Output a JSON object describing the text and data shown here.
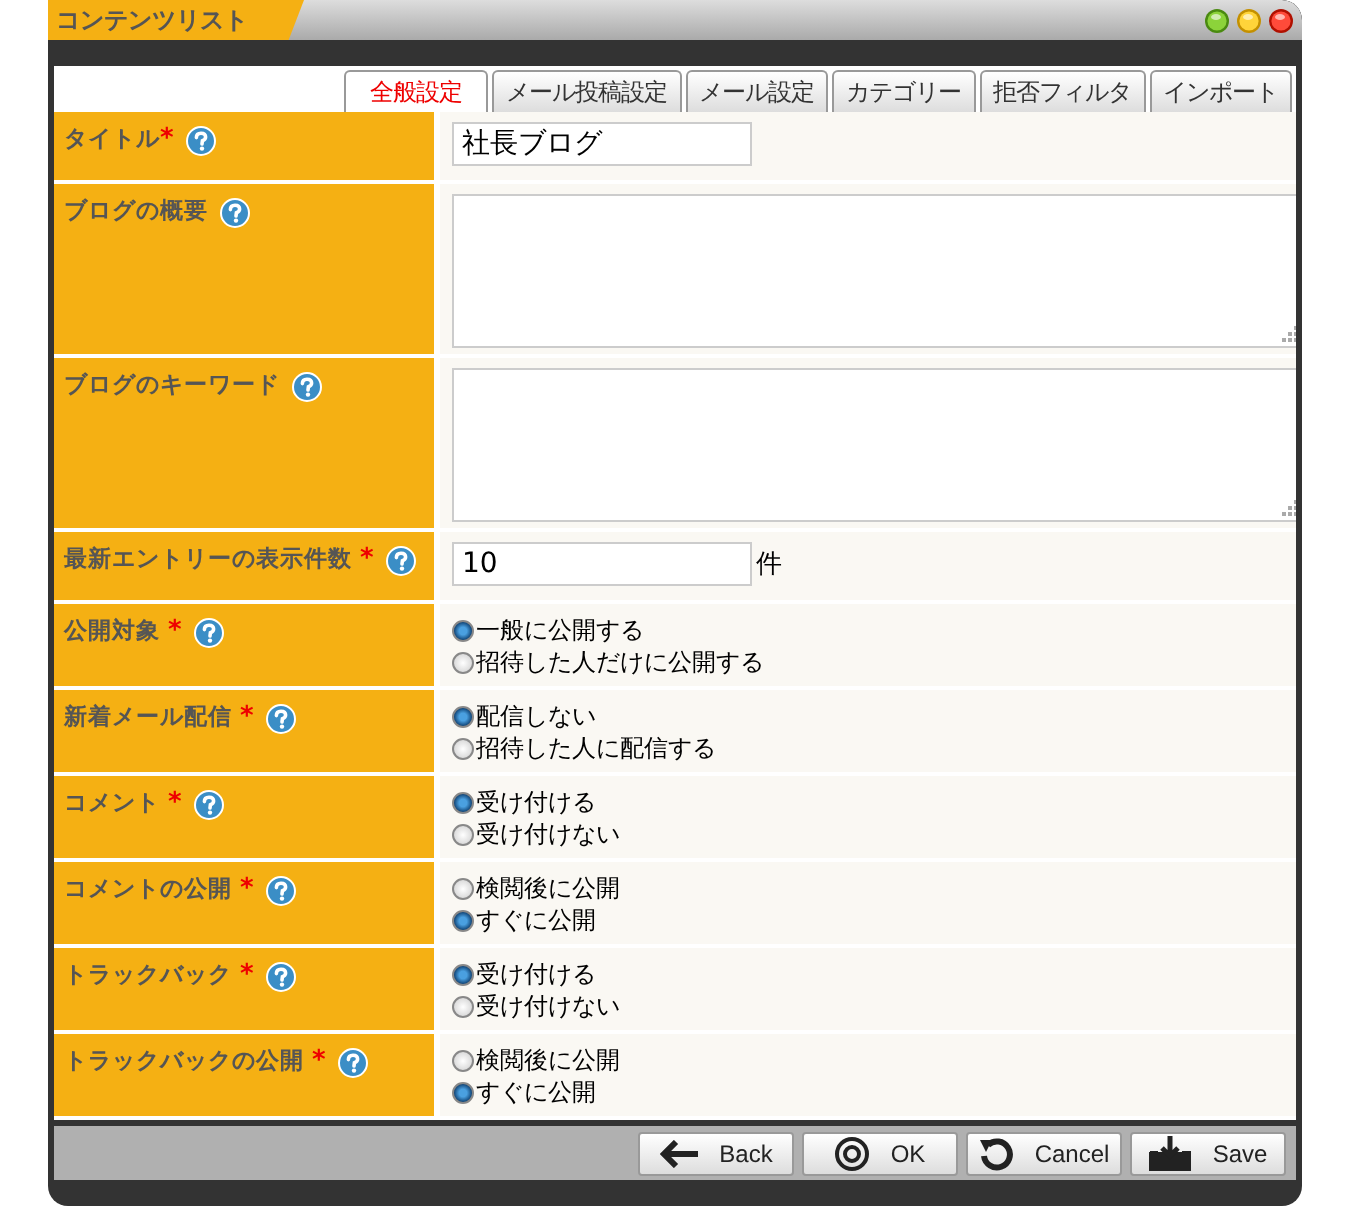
{
  "window": {
    "title": "コンテンツリスト"
  },
  "tabs": [
    {
      "label": "全般設定",
      "selected": true
    },
    {
      "label": "メール投稿設定",
      "selected": false
    },
    {
      "label": "メール設定",
      "selected": false
    },
    {
      "label": "カテゴリー",
      "selected": false
    },
    {
      "label": "拒否フィルタ",
      "selected": false
    },
    {
      "label": "インポート",
      "selected": false
    }
  ],
  "fields": [
    {
      "kind": "text",
      "label": "タイトル",
      "mark": "*",
      "value": "社長ブログ"
    },
    {
      "kind": "textarea",
      "label": "ブログの概要"
    },
    {
      "kind": "textarea",
      "label": "ブログのキーワード"
    },
    {
      "kind": "text",
      "label": "最新エントリーの表示件数",
      "mark": "*",
      "value": "10",
      "unit": "件"
    },
    {
      "kind": "radio",
      "label": "公開対象",
      "mark": "*",
      "options": [
        {
          "label": "一般に公開する",
          "selected": true
        },
        {
          "label": "招待した人だけに公開する",
          "selected": false
        }
      ]
    },
    {
      "kind": "radio",
      "label": "新着メール配信",
      "mark": "*",
      "options": [
        {
          "label": "配信しない",
          "selected": true
        },
        {
          "label": "招待した人に配信する",
          "selected": false
        }
      ]
    },
    {
      "kind": "radio",
      "label": "コメント",
      "mark": "*",
      "options": [
        {
          "label": "受け付ける",
          "selected": true
        },
        {
          "label": "受け付けない",
          "selected": false
        }
      ]
    },
    {
      "kind": "radio",
      "label": "コメントの公開",
      "mark": "*",
      "options": [
        {
          "label": "検閲後に公開",
          "selected": false
        },
        {
          "label": "すぐに公開",
          "selected": true
        }
      ]
    },
    {
      "kind": "radio",
      "label": "トラックバック",
      "mark": "*",
      "options": [
        {
          "label": "受け付ける",
          "selected": true
        },
        {
          "label": "受け付けない",
          "selected": false
        }
      ]
    },
    {
      "kind": "radio",
      "label": "トラックバックの公開",
      "mark": "*",
      "options": [
        {
          "label": "検閲後に公開",
          "selected": false
        },
        {
          "label": "すぐに公開",
          "selected": true
        }
      ]
    }
  ],
  "buttons": [
    {
      "kind": "back",
      "label": "Back"
    },
    {
      "kind": "ok",
      "label": "OK"
    },
    {
      "kind": "cancel",
      "label": "Cancel"
    },
    {
      "kind": "save",
      "label": "Save"
    }
  ]
}
